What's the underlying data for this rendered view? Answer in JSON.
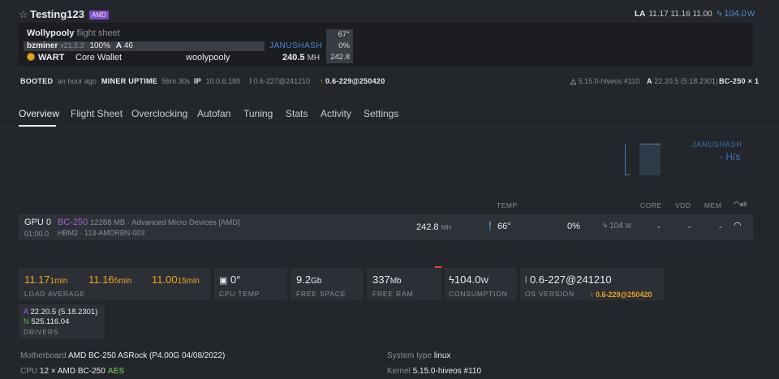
{
  "header": {
    "title": "Testing123",
    "badge": "AMD",
    "la_label": "LA",
    "la_values": "11.17 11.16 11.00",
    "power": "104.0",
    "power_unit": "W"
  },
  "flight_sheet": {
    "name": "Wollypooly",
    "suffix": "flight sheet",
    "miner": "bzminer",
    "miner_version": "v21.5.3",
    "miner_percent": "100%",
    "miner_a_label": "A",
    "miner_a_value": "46",
    "coin": "WART",
    "wallet": "Core Wallet",
    "pool": "woolypooly",
    "algo": "JANUSHASH",
    "hashrate": "240.5",
    "hashrate_unit": "MH",
    "stat_temp": "67°",
    "stat_fan": "0%",
    "stat_hash": "242.8"
  },
  "info": {
    "booted_label": "BOOTED",
    "booted_value": "an hour ago",
    "uptime_label": "MINER UPTIME",
    "uptime_value": "56m 30s",
    "ip_label": "IP",
    "ip_value": "10.0.6.180",
    "os_version": "0.6-227@241210",
    "os_update": "0.6-229@250420",
    "kernel": "5.15.0-hiveos #110",
    "amd_label": "A",
    "amd_driver": "22.20.5 (5.18.2301)",
    "gpu_count": "BC-250 × 1"
  },
  "tabs": [
    "Overview",
    "Flight Sheet",
    "Overclocking",
    "Autofan",
    "Tuning",
    "Stats",
    "Activity",
    "Settings"
  ],
  "hash_chart": {
    "algo": "JANUSHASH",
    "value": "- H/s"
  },
  "gpu_table": {
    "headers": {
      "temp": "TEMP",
      "core": "CORE",
      "vdd": "VDD",
      "mem": "MEM",
      "all": "all"
    },
    "row": {
      "name": "GPU 0",
      "bus": "01:00.0",
      "model": "BC-250",
      "memory": "12288 MB · Advanced Micro Devices [AMD]",
      "mem_type": "HBM2 · 113-AMDRBN-003",
      "hashrate": "242.8",
      "hashrate_unit": "MH",
      "temp": "66°",
      "fan": "0%",
      "power": "104",
      "power_unit": "W",
      "core": "-",
      "vdd": "-",
      "mem": "-"
    }
  },
  "cards": {
    "la1": "11.17",
    "la1_unit": "1min",
    "la5": "11.16",
    "la5_unit": "5min",
    "la15": "11.00",
    "la15_unit": "15min",
    "la_label": "LOAD AVERAGE",
    "cpu_temp": "0°",
    "cpu_temp_label": "CPU TEMP",
    "free_space": "9.2",
    "free_space_unit": "Gb",
    "free_space_label": "FREE SPACE",
    "free_ram": "337",
    "free_ram_unit": "Mb",
    "free_ram_label": "FREE RAM",
    "consumption": "104.0",
    "consumption_unit": "W",
    "consumption_label": "CONSUMPTION",
    "os_version": "0.6-227@241210",
    "os_label": "OS VERSION",
    "os_update": "0.6-229@250420"
  },
  "drivers": {
    "amd_label": "A",
    "amd": "22.20.5 (5.18.2301)",
    "nv_label": "N",
    "nv": "525.116.04",
    "label": "DRIVERS"
  },
  "specs": {
    "motherboard_label": "Motherboard",
    "motherboard": "AMD BC-250 ASRock (P4.00G 04/08/2022)",
    "cpu_label": "CPU",
    "cpu": "12 × AMD BC-250",
    "cpu_flag": "AES",
    "system_label": "System type",
    "system": "linux",
    "kernel_label": "Kernel",
    "kernel": "5.15.0-hiveos #110"
  },
  "colors": {
    "background": "#23262b",
    "panel": "#1b1d21",
    "accent_blue": "#4a8bd6",
    "accent_orange": "#f0a31c",
    "badge_purple": "#7d4fbf"
  }
}
